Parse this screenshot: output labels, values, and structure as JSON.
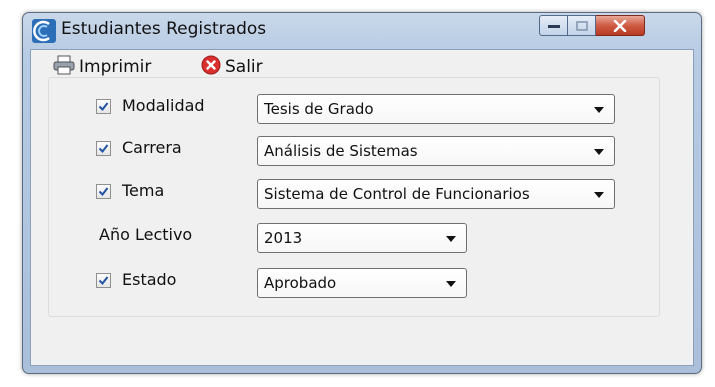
{
  "window": {
    "title": "Estudiantes Registrados"
  },
  "toolbar": {
    "print_label": "Imprimir",
    "exit_label": "Salir"
  },
  "form": {
    "modalidad": {
      "label": "Modalidad",
      "checked": true,
      "value": "Tesis de Grado"
    },
    "carrera": {
      "label": "Carrera",
      "checked": true,
      "value": "Análisis de Sistemas"
    },
    "tema": {
      "label": "Tema",
      "checked": true,
      "value": "Sistema de Control de Funcionarios"
    },
    "anio": {
      "label": "Año Lectivo",
      "value": "2013"
    },
    "estado": {
      "label": "Estado",
      "checked": true,
      "value": "Aprobado"
    }
  },
  "icons": {
    "app": "app-logo-icon",
    "print": "printer-icon",
    "exit": "exit-icon",
    "checkbox": "check-icon"
  },
  "colors": {
    "titlebar": "#b7cbe3",
    "close_button": "#cf5b44",
    "client_bg": "#f0f0f0"
  }
}
